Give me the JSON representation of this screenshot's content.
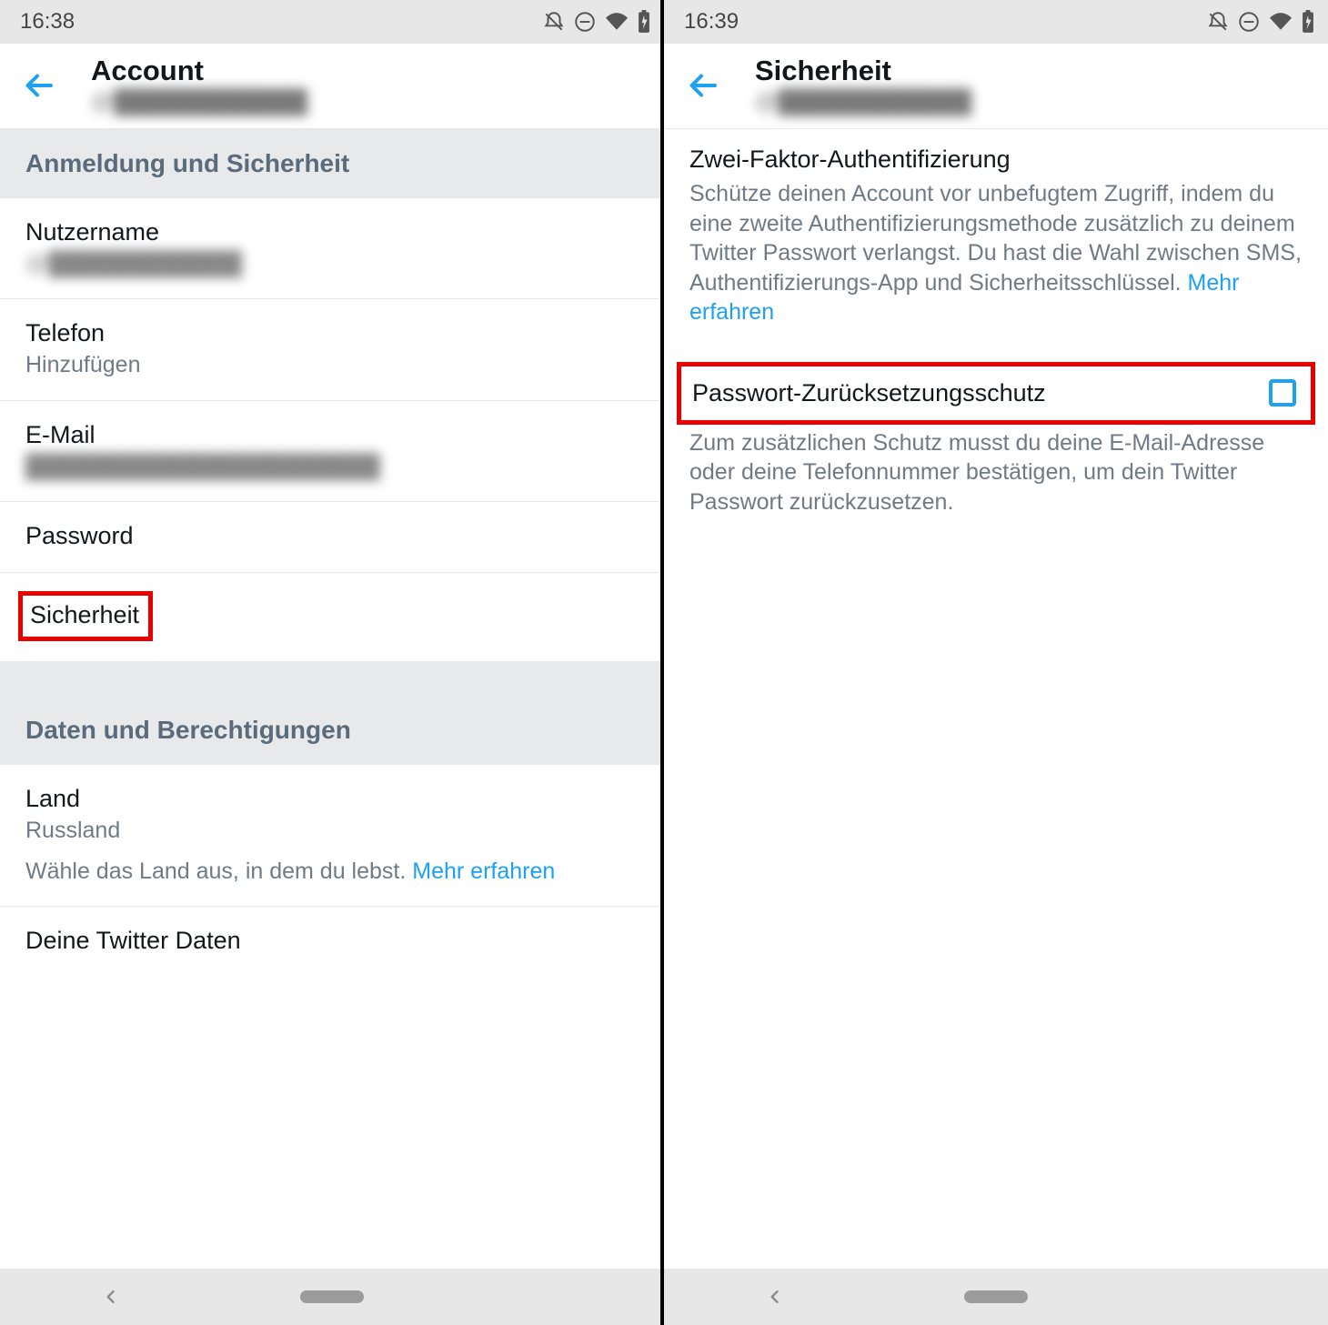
{
  "left": {
    "status": {
      "clock": "16:38"
    },
    "header": {
      "title": "Account",
      "handle": "@████████████"
    },
    "section1": "Anmeldung und Sicherheit",
    "items": {
      "username": {
        "title": "Nutzername",
        "sub": "@████████████"
      },
      "phone": {
        "title": "Telefon",
        "sub": "Hinzufügen"
      },
      "email": {
        "title": "E-Mail",
        "sub": "██████████████████████"
      },
      "password": {
        "title": "Password"
      },
      "security": {
        "title": "Sicherheit"
      }
    },
    "section2": "Daten und Berechtigungen",
    "country": {
      "title": "Land",
      "sub": "Russland",
      "desc": "Wähle das Land aus, in dem du lebst. ",
      "link": "Mehr erfahren"
    },
    "yourdata": {
      "title": "Deine Twitter Daten"
    }
  },
  "right": {
    "status": {
      "clock": "16:39"
    },
    "header": {
      "title": "Sicherheit",
      "handle": "@████████████"
    },
    "tfa": {
      "title": "Zwei-Faktor-Authentifizierung",
      "desc": "Schütze deinen Account vor unbefugtem Zugriff, indem du eine zweite Authentifizierungsmethode zusätzlich zu deinem Twitter Passwort verlangst. Du hast die Wahl zwischen SMS, Authentifizierungs-App und Sicherheitsschlüssel. ",
      "link": "Mehr erfahren"
    },
    "pwreset": {
      "title": "Passwort-Zurücksetzungsschutz",
      "desc": "Zum zusätzlichen Schutz musst du deine E-Mail-Adresse oder deine Telefonnummer bestätigen, um dein Twitter Passwort zurückzusetzen."
    }
  }
}
